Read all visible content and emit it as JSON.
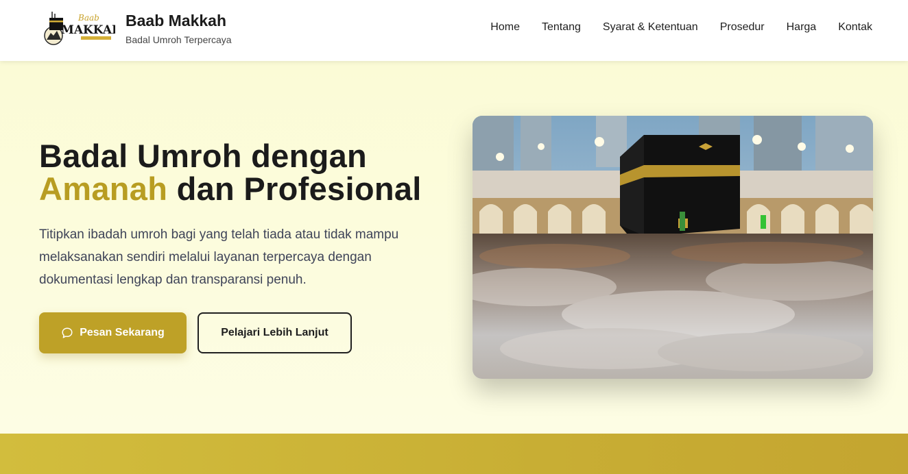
{
  "header": {
    "logo_top": "Baab",
    "logo_main": "MAKKAH",
    "brand_name": "Baab Makkah",
    "brand_tagline": "Badal Umroh Terpercaya"
  },
  "nav": [
    "Home",
    "Tentang",
    "Syarat & Ketentuan",
    "Prosedur",
    "Harga",
    "Kontak"
  ],
  "hero": {
    "title_line1": "Badal Umroh dengan",
    "title_accent": "Amanah",
    "title_rest": " dan Profesional",
    "description": "Titipkan ibadah umroh bagi yang telah tiada atau tidak mampu melaksanakan sendiri melalui layanan terpercaya dengan dokumentasi lengkap dan transparansi penuh.",
    "primary_button": "Pesan Sekarang",
    "secondary_button": "Pelajari Lebih Lanjut"
  },
  "icons": {
    "primary_button_icon": "chat-bubble-icon"
  },
  "colors": {
    "accent": "#bea127",
    "hero_background": "#fbfbd6",
    "band": "#c8ae34"
  }
}
